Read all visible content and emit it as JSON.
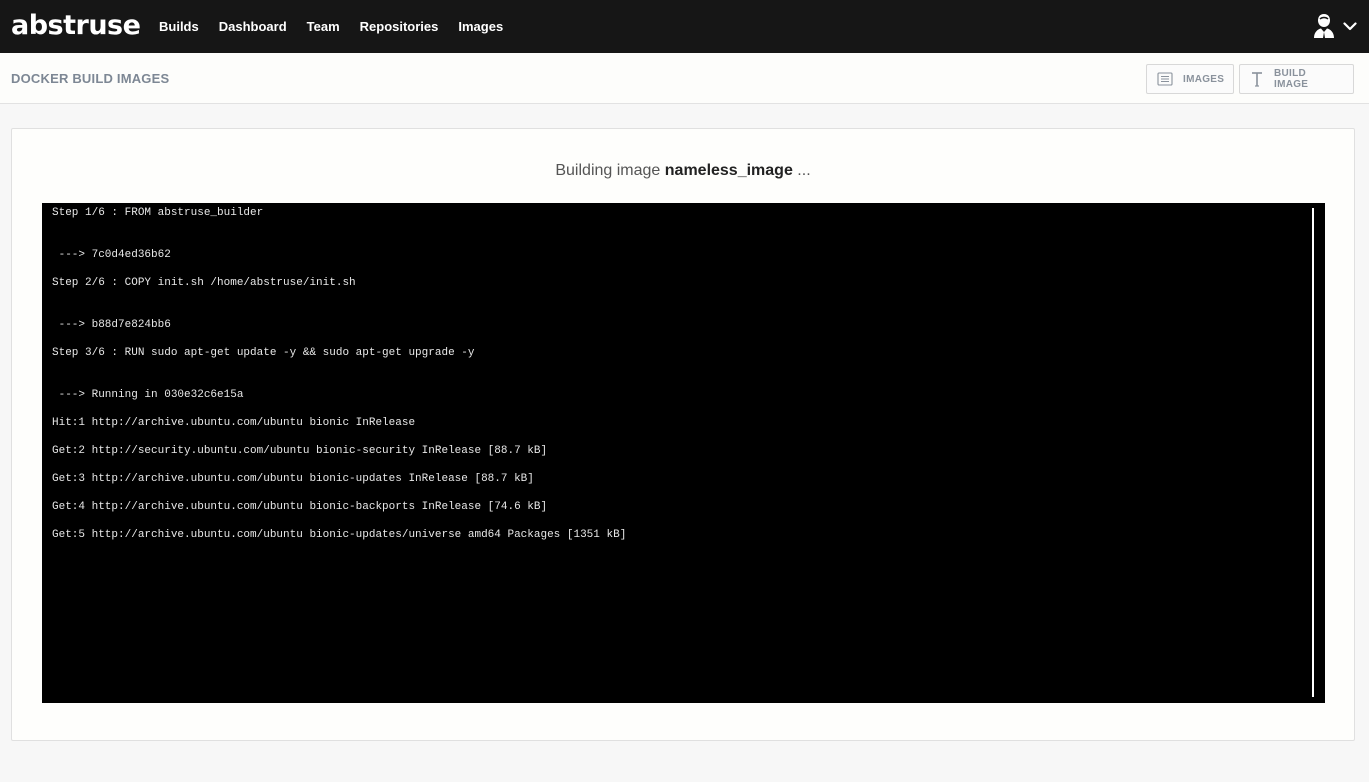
{
  "app": {
    "logo": "abstruse"
  },
  "nav": {
    "builds": "Builds",
    "dashboard": "Dashboard",
    "team": "Team",
    "repositories": "Repositories",
    "images": "Images"
  },
  "header": {
    "title": "DOCKER BUILD IMAGES",
    "images_button": "IMAGES",
    "build_image_button": "BUILD IMAGE"
  },
  "build": {
    "prefix": "Building image",
    "image_name": "nameless_image",
    "suffix": "..."
  },
  "terminal": {
    "lines": [
      "Step 1/6 : FROM abstruse_builder",
      " ---> 7c0d4ed36b62",
      "Step 2/6 : COPY init.sh /home/abstruse/init.sh",
      " ---> b88d7e824bb6",
      "Step 3/6 : RUN sudo apt-get update -y && sudo apt-get upgrade -y",
      " ---> Running in 030e32c6e15a",
      "Hit:1 http://archive.ubuntu.com/ubuntu bionic InRelease",
      "Get:2 http://security.ubuntu.com/ubuntu bionic-security InRelease [88.7 kB]",
      "Get:3 http://archive.ubuntu.com/ubuntu bionic-updates InRelease [88.7 kB]",
      "Get:4 http://archive.ubuntu.com/ubuntu bionic-backports InRelease [74.6 kB]",
      "Get:5 http://archive.ubuntu.com/ubuntu bionic-updates/universe amd64 Packages [1351 kB]"
    ]
  },
  "icons": {
    "user": "user-avatar-icon",
    "user_menu": "chevron-down-icon",
    "images": "list-icon",
    "build_image": "text-icon"
  },
  "colors": {
    "topbar": "#161616",
    "terminal_bg": "#000000",
    "terminal_text": "#e8e8e8"
  }
}
